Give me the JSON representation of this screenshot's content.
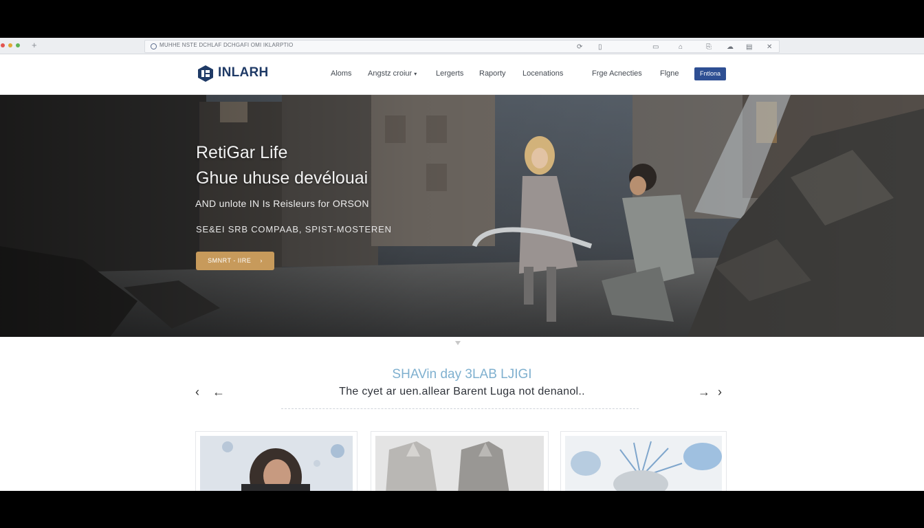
{
  "browser": {
    "new_tab_icon": "+",
    "url": "MUHHE NSTE DCHLAF DCHGAFI OMI IKLARPTIO",
    "toolbar_icons": [
      "reload-icon",
      "lock-icon",
      "tab-icon",
      "bookmark-icon",
      "share-icon",
      "cloud-icon",
      "trash-icon",
      "close-icon"
    ]
  },
  "header": {
    "logo_text": "INLARH",
    "nav": [
      "Aloms",
      "Angstz croiur",
      "Lergerts",
      "Raporty",
      "Locenations",
      "Frge Acnecties",
      "Flgne"
    ],
    "cta_label": "Fntlona"
  },
  "hero": {
    "title": "RetiGar Life",
    "line2": "Ghue uhuse devélouai",
    "line3": "AND unlote IN Is Reisleurs for ORSON",
    "line4": "SE&EI SRB COMPAAB, SPIST-MOSTEREN",
    "button_label": "SMNRT - IIRE"
  },
  "section": {
    "title": "SHAVin day 3LAB LJIGI",
    "subtitle": "The cyet ar uen.allear Barent Luga not denanol.."
  },
  "colors": {
    "brand": "#1f3a66",
    "nav_cta": "#2e4f93",
    "hero_button": "#c79a5b",
    "section_title": "#7fb0cf"
  }
}
